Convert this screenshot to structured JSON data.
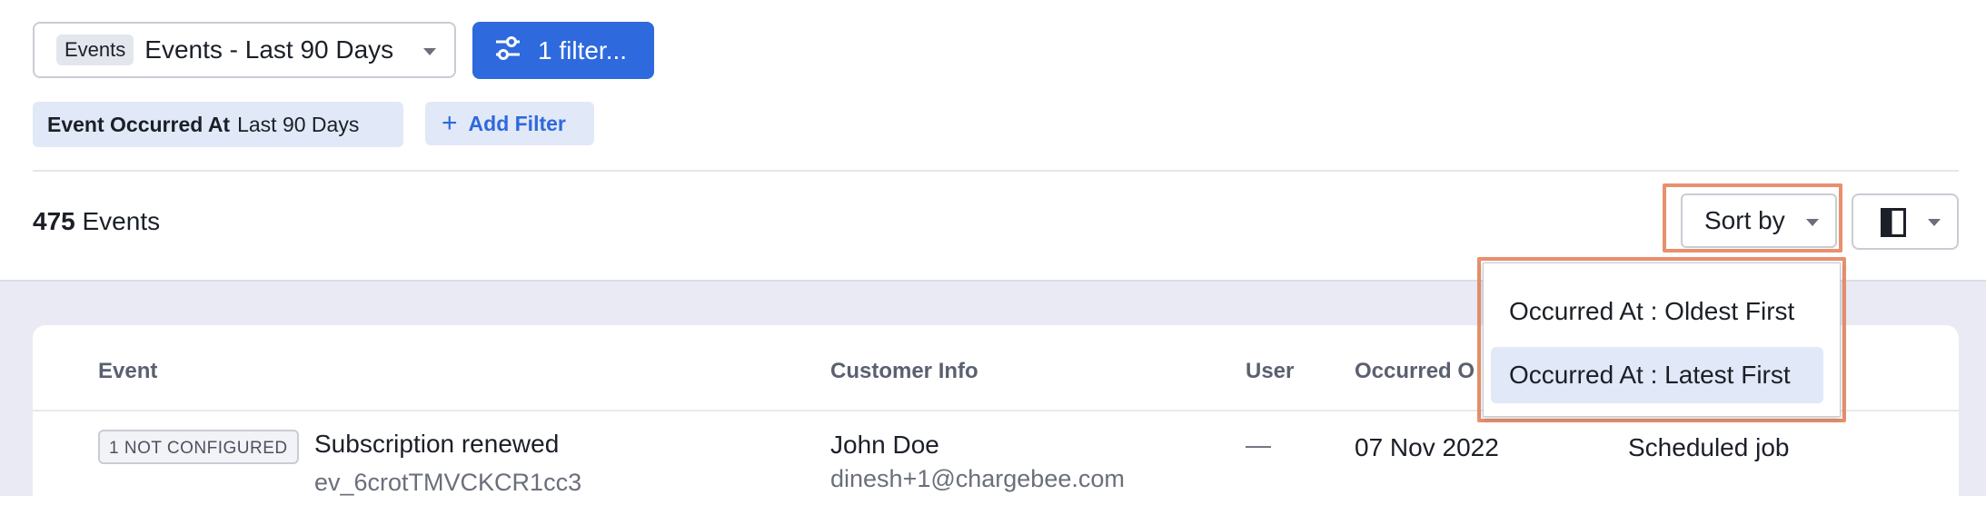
{
  "view_selector": {
    "badge": "Events",
    "label": "Events - Last 90 Days"
  },
  "filter_button": {
    "label": "1 filter..."
  },
  "active_filter": {
    "key": "Event Occurred At",
    "value": "Last 90 Days"
  },
  "add_filter": {
    "label": "Add Filter"
  },
  "results": {
    "count": "475",
    "unit": "Events"
  },
  "sort": {
    "label": "Sort by",
    "options": [
      "Occurred At : Oldest First",
      "Occurred At : Latest First"
    ],
    "selected_index": 1
  },
  "table": {
    "headers": [
      "Event",
      "Customer Info",
      "User",
      "Occurred O"
    ],
    "rows": [
      {
        "status": "1 NOT CONFIGURED",
        "event": "Subscription renewed",
        "event_id": "ev_6crotTMVCKCR1cc3",
        "customer_name": "John Doe",
        "customer_email": "dinesh+1@chargebee.com",
        "user": "—",
        "occurred": "07 Nov 2022",
        "source": "Scheduled job"
      }
    ]
  },
  "colors": {
    "primary": "#2e69dd",
    "highlight": "#e8906e",
    "chip_bg": "#e1e8f7",
    "page_bg": "#e9eaf3"
  }
}
